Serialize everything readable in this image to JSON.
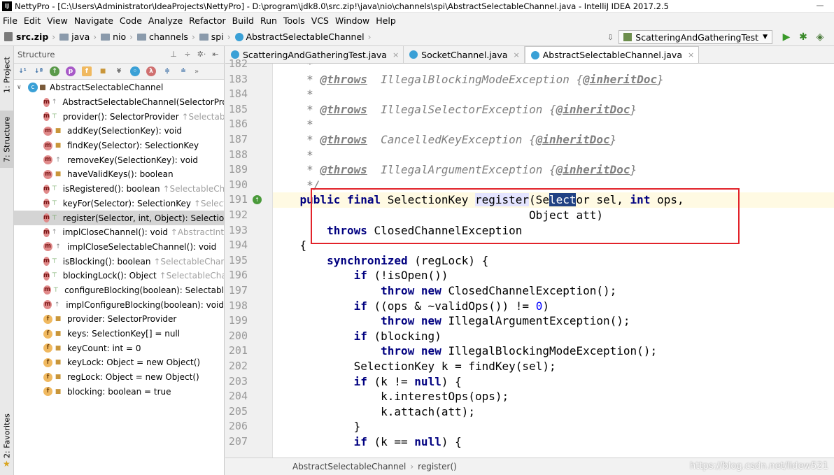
{
  "titlebar": {
    "title": "NettyPro - [C:\\Users\\Administrator\\IdeaProjects\\NettyPro] - D:\\program\\jdk8.0\\src.zip!\\java\\nio\\channels\\spi\\AbstractSelectableChannel.java - IntelliJ IDEA 2017.2.5"
  },
  "menu": [
    "File",
    "Edit",
    "View",
    "Navigate",
    "Code",
    "Analyze",
    "Refactor",
    "Build",
    "Run",
    "Tools",
    "VCS",
    "Window",
    "Help"
  ],
  "breadcrumbs": [
    "src.zip",
    "java",
    "nio",
    "channels",
    "spi",
    "AbstractSelectableChannel"
  ],
  "run_config": "ScatteringAndGatheringTest",
  "left_strip": {
    "project_tab": "1: Project",
    "structure_tab": "7: Structure",
    "favorites_tab": "2: Favorites"
  },
  "structure": {
    "title": "Structure",
    "root": "AbstractSelectableChannel",
    "items": [
      {
        "kind": "m",
        "vis": "pkg",
        "label": "AbstractSelectableChannel(SelectorProv",
        "inherit": ""
      },
      {
        "kind": "m",
        "vis": "pub",
        "label": "provider(): SelectorProvider ",
        "inherit": "↑Selectable"
      },
      {
        "kind": "m",
        "vis": "lock",
        "label": "addKey(SelectionKey): void",
        "inherit": ""
      },
      {
        "kind": "m",
        "vis": "lock",
        "label": "findKey(Selector): SelectionKey",
        "inherit": ""
      },
      {
        "kind": "m",
        "vis": "pkg",
        "label": "removeKey(SelectionKey): void",
        "inherit": ""
      },
      {
        "kind": "m",
        "vis": "lock",
        "label": "haveValidKeys(): boolean",
        "inherit": ""
      },
      {
        "kind": "m",
        "vis": "pub",
        "label": "isRegistered(): boolean ",
        "inherit": "↑SelectableChan"
      },
      {
        "kind": "m",
        "vis": "pub",
        "label": "keyFor(Selector): SelectionKey ",
        "inherit": "↑Selectab"
      },
      {
        "kind": "m",
        "vis": "pub",
        "label": "register(Selector, int, Object): SelectionK",
        "inherit": ""
      },
      {
        "kind": "m",
        "vis": "pkg",
        "label": "implCloseChannel(): void ",
        "inherit": "↑AbstractInter"
      },
      {
        "kind": "m",
        "vis": "pkg",
        "label": "implCloseSelectableChannel(): void",
        "inherit": ""
      },
      {
        "kind": "m",
        "vis": "pub",
        "label": "isBlocking(): boolean ",
        "inherit": "↑SelectableChann"
      },
      {
        "kind": "m",
        "vis": "pub",
        "label": "blockingLock(): Object ",
        "inherit": "↑SelectableChan"
      },
      {
        "kind": "m",
        "vis": "pub",
        "label": "configureBlocking(boolean): Selectabl",
        "inherit": ""
      },
      {
        "kind": "m",
        "vis": "pkg",
        "label": "implConfigureBlocking(boolean): void",
        "inherit": ""
      },
      {
        "kind": "f",
        "vis": "lock",
        "label": "provider: SelectorProvider",
        "inherit": ""
      },
      {
        "kind": "f",
        "vis": "lock",
        "label": "keys: SelectionKey[] = null",
        "inherit": ""
      },
      {
        "kind": "f",
        "vis": "lock",
        "label": "keyCount: int = 0",
        "inherit": ""
      },
      {
        "kind": "f",
        "vis": "lock",
        "label": "keyLock: Object = new Object()",
        "inherit": ""
      },
      {
        "kind": "f",
        "vis": "lock",
        "label": "regLock: Object = new Object()",
        "inherit": ""
      },
      {
        "kind": "f",
        "vis": "lock",
        "label": "blocking: boolean = true",
        "inherit": ""
      }
    ]
  },
  "tabs": [
    {
      "label": "ScatteringAndGatheringTest.java",
      "active": false
    },
    {
      "label": "SocketChannel.java",
      "active": false
    },
    {
      "label": "AbstractSelectableChannel.java",
      "active": true
    }
  ],
  "code": {
    "lines": [
      {
        "n": "182",
        "html": "     <span class=\"cm\">*</span>"
      },
      {
        "n": "183",
        "html": "     <span class=\"cm\">* </span><span class=\"tag\">@throws</span><span class=\"cm\">  IllegalBlockingModeException {</span><span class=\"tag\">@inheritDoc</span><span class=\"cm\">}</span>"
      },
      {
        "n": "184",
        "html": "     <span class=\"cm\">*</span>"
      },
      {
        "n": "185",
        "html": "     <span class=\"cm\">* </span><span class=\"tag\">@throws</span><span class=\"cm\">  IllegalSelectorException {</span><span class=\"tag\">@inheritDoc</span><span class=\"cm\">}</span>"
      },
      {
        "n": "186",
        "html": "     <span class=\"cm\">*</span>"
      },
      {
        "n": "187",
        "html": "     <span class=\"cm\">* </span><span class=\"tag\">@throws</span><span class=\"cm\">  CancelledKeyException {</span><span class=\"tag\">@inheritDoc</span><span class=\"cm\">}</span>"
      },
      {
        "n": "188",
        "html": "     <span class=\"cm\">*</span>"
      },
      {
        "n": "189",
        "html": "     <span class=\"cm\">* </span><span class=\"tag\">@throws</span><span class=\"cm\">  IllegalArgumentException {</span><span class=\"tag\">@inheritDoc</span><span class=\"cm\">}</span>"
      },
      {
        "n": "190",
        "html": "     <span class=\"cm\">*/</span>"
      },
      {
        "n": "191",
        "html": "    <span class=\"kw\">public final</span> SelectionKey <span class=\"hl-usage\">register</span>(Se<span class=\"hl-sel\">lect</span>or sel, <span class=\"kw\">int</span> ops,"
      },
      {
        "n": "192",
        "html": "                                      Object att)"
      },
      {
        "n": "193",
        "html": "        <span class=\"kw\">throws</span> ClosedChannelException"
      },
      {
        "n": "194",
        "html": "    {"
      },
      {
        "n": "195",
        "html": "        <span class=\"kw\">synchronized</span> (regLock) {"
      },
      {
        "n": "196",
        "html": "            <span class=\"kw\">if</span> (!isOpen())"
      },
      {
        "n": "197",
        "html": "                <span class=\"kw\">throw new</span> ClosedChannelException();"
      },
      {
        "n": "198",
        "html": "            <span class=\"kw\">if</span> ((ops &amp; ~validOps()) != <span class=\"num\">0</span>)"
      },
      {
        "n": "199",
        "html": "                <span class=\"kw\">throw new</span> IllegalArgumentException();"
      },
      {
        "n": "200",
        "html": "            <span class=\"kw\">if</span> (blocking)"
      },
      {
        "n": "201",
        "html": "                <span class=\"kw\">throw new</span> IllegalBlockingModeException();"
      },
      {
        "n": "202",
        "html": "            SelectionKey k = findKey(sel);"
      },
      {
        "n": "203",
        "html": "            <span class=\"kw\">if</span> (k != <span class=\"kw\">null</span>) {"
      },
      {
        "n": "204",
        "html": "                k.interestOps(ops);"
      },
      {
        "n": "205",
        "html": "                k.attach(att);"
      },
      {
        "n": "206",
        "html": "            }"
      },
      {
        "n": "207",
        "html": "            <span class=\"kw\">if</span> (k == <span class=\"kw\">null</span>) {"
      }
    ]
  },
  "status": {
    "class_crumb": "AbstractSelectableChannel",
    "method_crumb": "register()",
    "watermark": "https://blog.csdn.net/lidew521"
  }
}
